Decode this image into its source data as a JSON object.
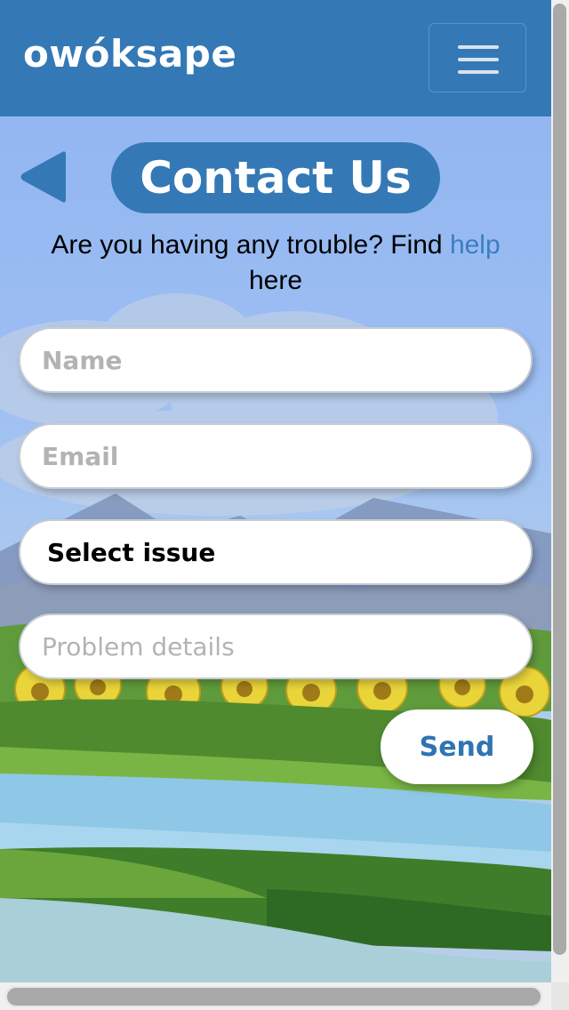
{
  "header": {
    "brand": "owóksape",
    "menu_icon": "hamburger-icon"
  },
  "page": {
    "back_icon": "back-triangle-icon",
    "title": "Contact Us",
    "help_prefix": "Are you having any trouble? Find ",
    "help_link": "help",
    "help_suffix": "here"
  },
  "form": {
    "name_placeholder": "Name",
    "email_placeholder": "Email",
    "issue_selected": "Select issue",
    "details_placeholder": "Problem details",
    "send_label": "Send"
  },
  "colors": {
    "brand_blue": "#3479b6",
    "link_blue": "#3a7fc0",
    "sky": "#9bbdf3"
  }
}
